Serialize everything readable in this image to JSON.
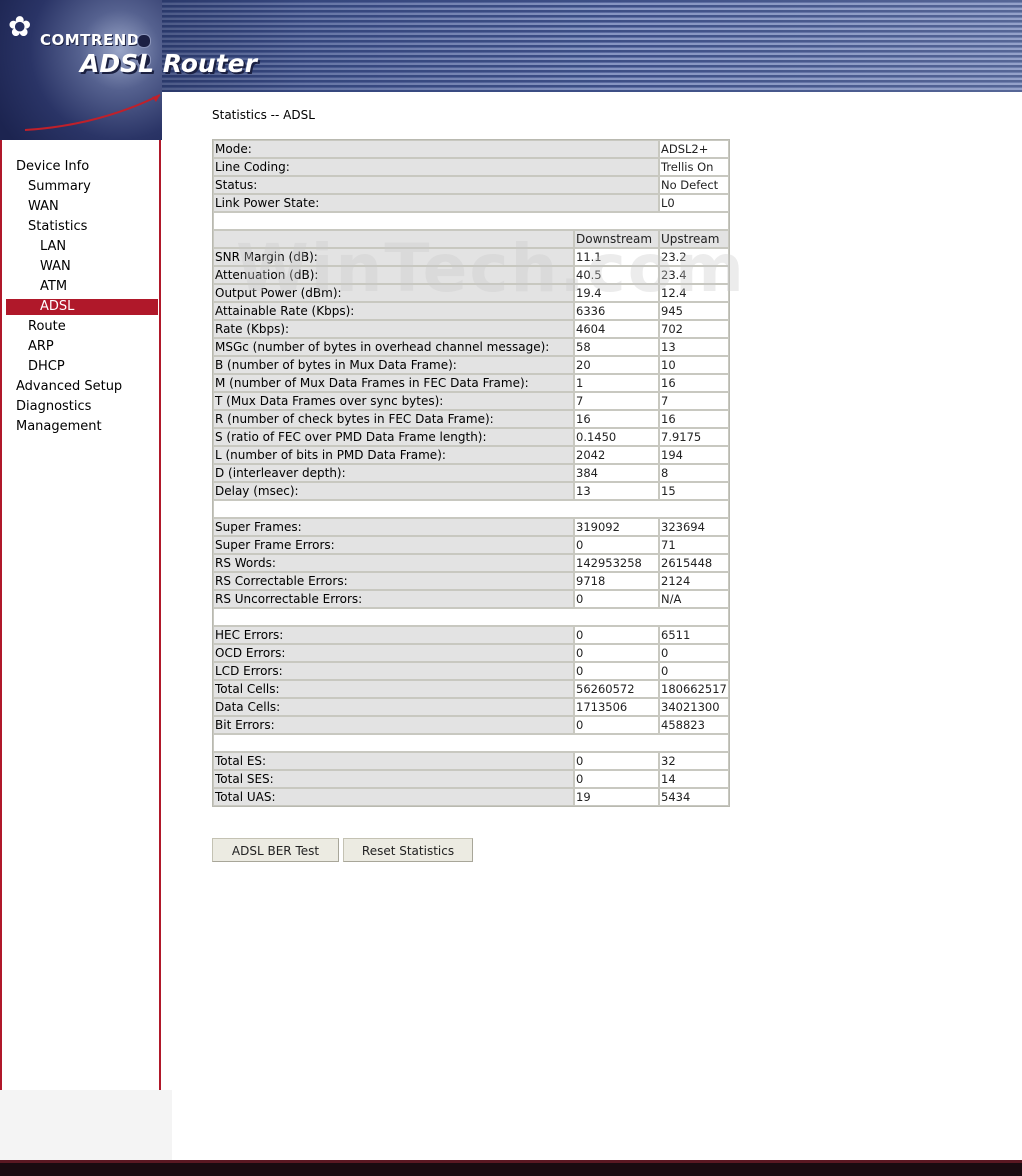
{
  "brand": {
    "company": "COMTREND",
    "product": "ADSL Router",
    "colors": {
      "accent": "#b0182a",
      "banner": "#3d4f86",
      "label_bg": "#e3e3e3"
    }
  },
  "sidebar": {
    "items": [
      {
        "label": "Device Info"
      },
      {
        "label": "Summary"
      },
      {
        "label": "WAN"
      },
      {
        "label": "Statistics"
      },
      {
        "label": "LAN"
      },
      {
        "label": "WAN"
      },
      {
        "label": "ATM"
      },
      {
        "label": "ADSL"
      },
      {
        "label": "Route"
      },
      {
        "label": "ARP"
      },
      {
        "label": "DHCP"
      },
      {
        "label": "Advanced Setup"
      },
      {
        "label": "Diagnostics"
      },
      {
        "label": "Management"
      }
    ],
    "active": "ADSL"
  },
  "page": {
    "title": "Statistics -- ADSL"
  },
  "line_info": {
    "mode_label": "Mode:",
    "mode_value": "ADSL2+",
    "coding_label": "Line Coding:",
    "coding_value": "Trellis On",
    "status_label": "Status:",
    "status_value": "No Defect",
    "power_label": "Link Power State:",
    "power_value": "L0"
  },
  "table": {
    "headers": {
      "downstream": "Downstream",
      "upstream": "Upstream"
    },
    "group1": [
      {
        "label": "SNR Margin (dB):",
        "ds": "11.1",
        "us": "23.2"
      },
      {
        "label": "Attenuation (dB):",
        "ds": "40.5",
        "us": "23.4"
      },
      {
        "label": "Output Power (dBm):",
        "ds": "19.4",
        "us": "12.4"
      },
      {
        "label": "Attainable Rate (Kbps):",
        "ds": "6336",
        "us": "945"
      },
      {
        "label": "Rate (Kbps):",
        "ds": "4604",
        "us": "702"
      },
      {
        "label": "MSGc (number of bytes in overhead channel message):",
        "ds": "58",
        "us": "13"
      },
      {
        "label": "B (number of bytes in Mux Data Frame):",
        "ds": "20",
        "us": "10"
      },
      {
        "label": "M (number of Mux Data Frames in FEC Data Frame):",
        "ds": "1",
        "us": "16"
      },
      {
        "label": "T (Mux Data Frames over sync bytes):",
        "ds": "7",
        "us": "7"
      },
      {
        "label": "R (number of check bytes in FEC Data Frame):",
        "ds": "16",
        "us": "16"
      },
      {
        "label": "S (ratio of FEC over PMD Data Frame length):",
        "ds": "0.1450",
        "us": "7.9175"
      },
      {
        "label": "L (number of bits in PMD Data Frame):",
        "ds": "2042",
        "us": "194"
      },
      {
        "label": "D (interleaver depth):",
        "ds": "384",
        "us": "8"
      },
      {
        "label": "Delay (msec):",
        "ds": "13",
        "us": "15"
      }
    ],
    "group2": [
      {
        "label": "Super Frames:",
        "ds": "319092",
        "us": "323694"
      },
      {
        "label": "Super Frame Errors:",
        "ds": "0",
        "us": "71"
      },
      {
        "label": "RS Words:",
        "ds": "142953258",
        "us": "2615448"
      },
      {
        "label": "RS Correctable Errors:",
        "ds": "9718",
        "us": "2124"
      },
      {
        "label": "RS Uncorrectable Errors:",
        "ds": "0",
        "us": "N/A"
      }
    ],
    "group3": [
      {
        "label": "HEC Errors:",
        "ds": "0",
        "us": "6511"
      },
      {
        "label": "OCD Errors:",
        "ds": "0",
        "us": "0"
      },
      {
        "label": "LCD Errors:",
        "ds": "0",
        "us": "0"
      },
      {
        "label": "Total Cells:",
        "ds": "56260572",
        "us": "180662517"
      },
      {
        "label": "Data Cells:",
        "ds": "1713506",
        "us": "34021300"
      },
      {
        "label": "Bit Errors:",
        "ds": "0",
        "us": "458823"
      }
    ],
    "group4": [
      {
        "label": "Total ES:",
        "ds": "0",
        "us": "32"
      },
      {
        "label": "Total SES:",
        "ds": "0",
        "us": "14"
      },
      {
        "label": "Total UAS:",
        "ds": "19",
        "us": "5434"
      }
    ]
  },
  "buttons": {
    "ber_test": "ADSL BER Test",
    "reset": "Reset Statistics"
  },
  "watermark": "WinTech.com"
}
